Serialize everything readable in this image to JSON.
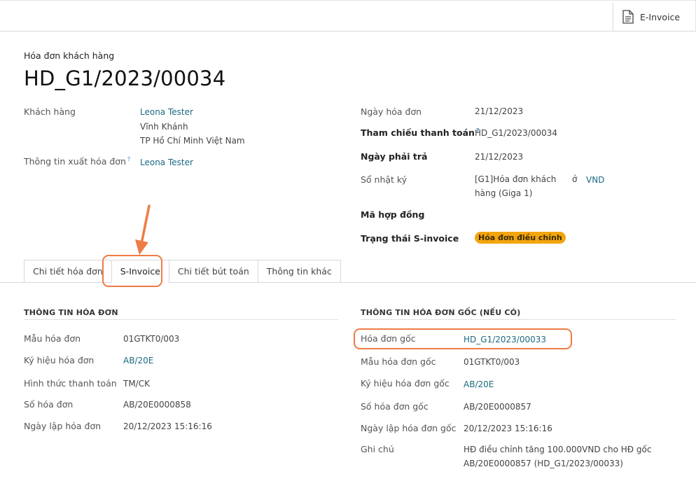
{
  "toolbar": {
    "einvoice_label": "E-Invoice"
  },
  "header": {
    "doc_type": "Hóa đơn khách hàng",
    "doc_name": "HD_G1/2023/00034"
  },
  "left_fields": {
    "customer_label": "Khách hàng",
    "customer_name": "Leona Tester",
    "customer_addr1": "Vĩnh Khánh",
    "customer_addr2": "TP Hồ Chí Minh Việt Nam",
    "billing_label": "Thông tin xuất hóa đơn",
    "billing_help": "?",
    "billing_value": "Leona Tester"
  },
  "right_fields": {
    "invoice_date_label": "Ngày hóa đơn",
    "invoice_date": "21/12/2023",
    "payment_ref_label": "Tham chiếu thanh toán",
    "payment_ref_help": "?",
    "payment_ref": "HD_G1/2023/00034",
    "due_date_label": "Ngày phải trả",
    "due_date": "21/12/2023",
    "journal_label": "Sổ nhật ký",
    "journal_line1": "[G1]Hóa đơn khách",
    "journal_line2": "hàng (Giga 1)",
    "currency_in": "ở",
    "currency": "VND",
    "contract_label": "Mã hợp đồng",
    "sinvoice_status_label": "Trạng thái S-invoice",
    "sinvoice_status": "Hóa đơn điều chỉnh"
  },
  "tabs": [
    {
      "label": "Chi tiết hóa đơn"
    },
    {
      "label": "S-Invoice"
    },
    {
      "label": "Chi tiết bút toán"
    },
    {
      "label": "Thông tin khác"
    }
  ],
  "invoice_info": {
    "title": "THÔNG TIN HÓA ĐƠN",
    "template_label": "Mẫu hóa đơn",
    "template": "01GTKT0/003",
    "symbol_label": "Ký hiệu hóa đơn",
    "symbol": "AB/20E",
    "payment_method_label": "Hình thức thanh toán",
    "payment_method": "TM/CK",
    "number_label": "Số hóa đơn",
    "number": "AB/20E0000858",
    "created_label": "Ngày lập hóa đơn",
    "created": "20/12/2023 15:16:16"
  },
  "original_info": {
    "title": "THÔNG TIN HÓA ĐƠN GỐC (NẾU CÓ)",
    "orig_label": "Hóa đơn gốc",
    "orig": "HD_G1/2023/00033",
    "template_label": "Mẫu hóa đơn gốc",
    "template": "01GTKT0/003",
    "symbol_label": "Ký hiệu hóa đơn gốc",
    "symbol": "AB/20E",
    "number_label": "Số hóa đơn gốc",
    "number": "AB/20E0000857",
    "created_label": "Ngày lập hóa đơn gốc",
    "created": "20/12/2023 15:16:16",
    "note_label": "Ghi chú",
    "note_line1": "HĐ điều chỉnh tăng 100.000VND cho HĐ gốc",
    "note_line2": "AB/20E0000857 (HD_G1/2023/00033)"
  },
  "colors": {
    "accent": "#1c6a80",
    "badge": "#f2a50c",
    "highlight": "#ef7b45"
  }
}
